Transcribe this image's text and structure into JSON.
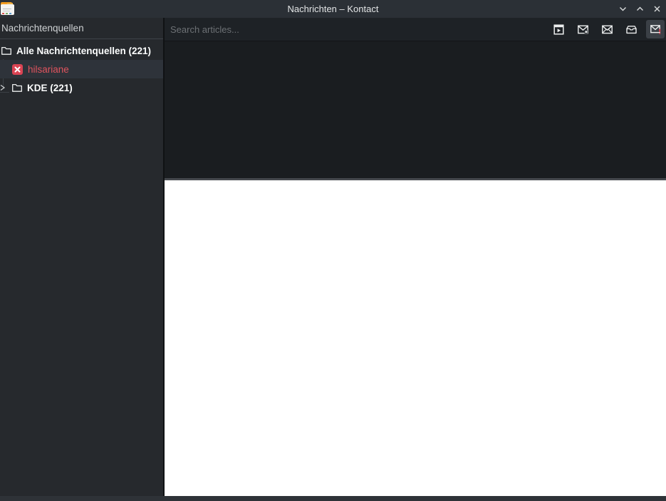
{
  "window": {
    "title": "Nachrichten – Kontact"
  },
  "sidebar": {
    "header": "Nachrichtenquellen",
    "tree": [
      {
        "label": "Alle Nachrichtenquellen (221)",
        "icon": "folder-icon",
        "count": 221,
        "bold": true
      },
      {
        "label": "hilsariane",
        "icon": "feed-error-icon",
        "status": "error",
        "selected": true
      },
      {
        "label": "KDE (221)",
        "icon": "folder-icon",
        "count": 221,
        "bold": true,
        "collapsed": true
      }
    ]
  },
  "main": {
    "search": {
      "placeholder": "Search articles..."
    },
    "toolbar": [
      {
        "icon": "play-box-icon"
      },
      {
        "icon": "envelope-new-icon"
      },
      {
        "icon": "envelope-unread-icon"
      },
      {
        "icon": "mail-open-tray-icon"
      },
      {
        "icon": "envelope-important-icon",
        "active": true
      }
    ]
  },
  "colors": {
    "titlebar_bg": "#2b3036",
    "sidebar_bg": "#26292d",
    "list_bg": "#1a1d20",
    "viewer_bg": "#ffffff",
    "selected_row_bg": "#2e333a",
    "error_red": "#da4453",
    "error_text": "#e0545e"
  }
}
